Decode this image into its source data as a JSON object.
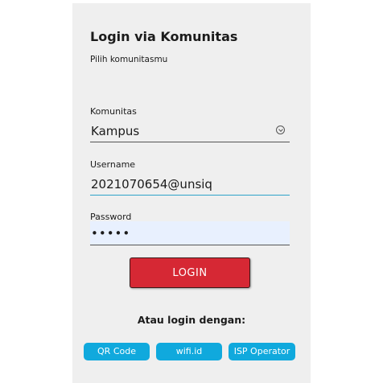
{
  "header": {
    "title": "Login via Komunitas",
    "subtitle": "Pilih komunitasmu"
  },
  "form": {
    "community_label": "Komunitas",
    "community_value": "Kampus",
    "username_label": "Username",
    "username_value": "2021070654@unsiq",
    "password_label": "Password",
    "password_value": "•••••",
    "login_label": "LOGIN"
  },
  "alternatives": {
    "heading": "Atau login dengan:",
    "options": [
      "QR Code",
      "wifi.id",
      "ISP Operator"
    ]
  },
  "colors": {
    "primary_button": "#d62834",
    "secondary_button": "#10a9dd",
    "panel_background": "#efefef",
    "focus_underline": "#2ea3c9",
    "autofill_background": "#e8f0fe"
  },
  "icons": {
    "community_dropdown": "chevron-down-circle-icon"
  }
}
